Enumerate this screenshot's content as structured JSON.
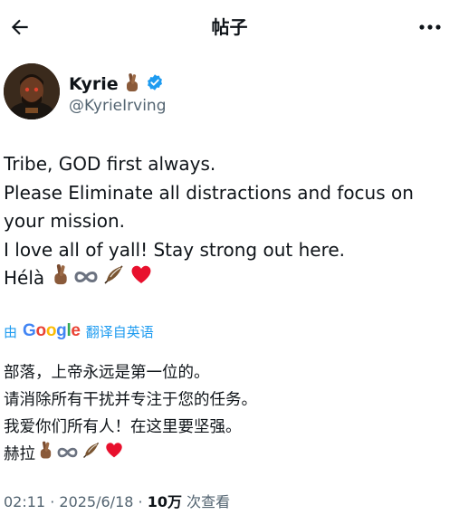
{
  "header": {
    "title": "帖子",
    "back_icon": "arrow-left-icon",
    "more_icon": "more-horizontal-icon"
  },
  "author": {
    "display_name": "Kyrie",
    "handle": "@KyrieIrving",
    "verified_icon": "verified-badge-icon",
    "name_emoji": "crossed-fingers-emoji",
    "verified_color": "#1d9bf0"
  },
  "tweet": {
    "lines": [
      "Tribe, GOD first always.",
      "Please Eliminate all distractions and focus on",
      "your mission.",
      "I love all of yall! Stay strong out here.",
      "Hélà"
    ],
    "last_line_emojis": [
      "crossed-fingers-emoji",
      "infinity-emoji",
      "feather-emoji",
      "red-heart-emoji"
    ]
  },
  "translation": {
    "prefix": "由",
    "provider": "Google",
    "label": "翻译自英语",
    "link_color": "#1d9bf0",
    "lines": [
      "部落，上帝永远是第一位的。",
      "请消除所有干扰并专注于您的任务。",
      "我爱你们所有人！在这里要坚强。",
      "赫拉"
    ]
  },
  "meta": {
    "time": "02:11",
    "date": "2025/6/18",
    "views_count": "10万",
    "views_label": "次查看",
    "separator": "·"
  }
}
